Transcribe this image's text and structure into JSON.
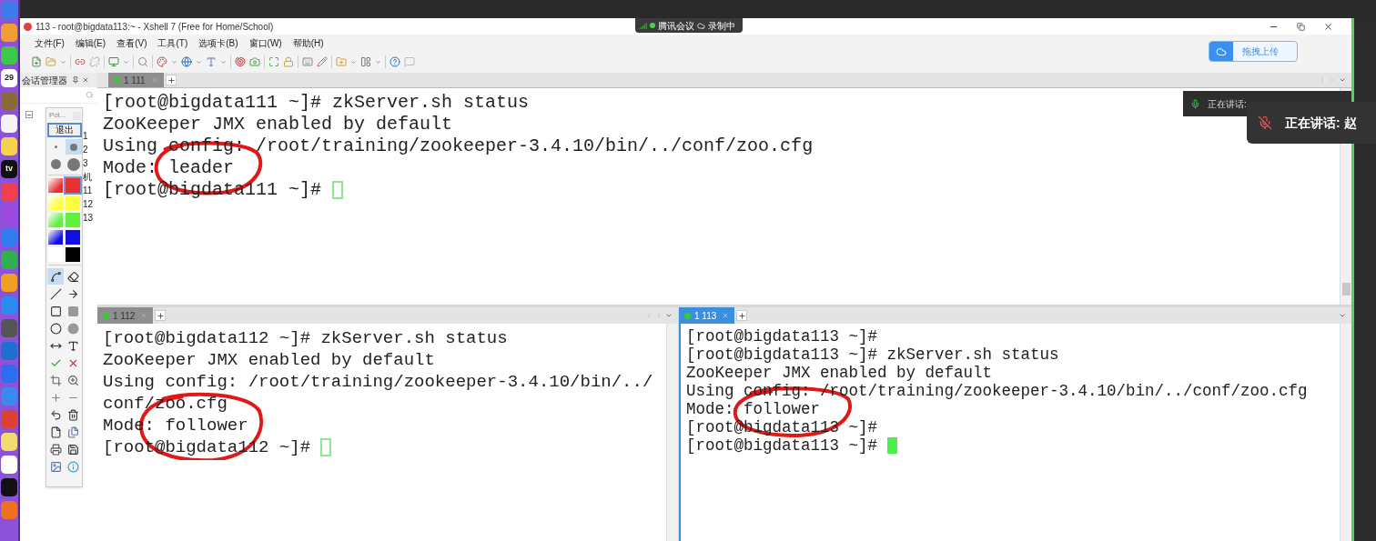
{
  "window": {
    "title": "113 - root@bigdata113:~ - Xshell 7 (Free for Home/School)"
  },
  "menu": [
    "文件(F)",
    "编辑(E)",
    "查看(V)",
    "工具(T)",
    "选项卡(B)",
    "窗口(W)",
    "帮助(H)"
  ],
  "session_manager": {
    "title": "会话管理器",
    "tree_fragments": [
      "1",
      "2",
      "3",
      "机",
      "11",
      "12",
      "13"
    ]
  },
  "panes": [
    {
      "tab": {
        "label": "1 111",
        "selected": false
      },
      "focused": false,
      "lines": [
        "[root@bigdata111 ~]# zkServer.sh status",
        "ZooKeeper JMX enabled by default",
        "Using config: /root/training/zookeeper-3.4.10/bin/../conf/zoo.cfg",
        "Mode: leader",
        "[root@bigdata111 ~]# "
      ]
    },
    {
      "tab": {
        "label": "1 112",
        "selected": false
      },
      "focused": false,
      "lines": [
        "[root@bigdata112 ~]# zkServer.sh status",
        "ZooKeeper JMX enabled by default",
        "Using config: /root/training/zookeeper-3.4.10/bin/../",
        "conf/zoo.cfg",
        "Mode: follower",
        "[root@bigdata112 ~]# "
      ]
    },
    {
      "tab": {
        "label": "1 113",
        "selected": true
      },
      "focused": true,
      "lines": [
        "[root@bigdata113 ~]#",
        "[root@bigdata113 ~]# zkServer.sh status",
        "ZooKeeper JMX enabled by default",
        "Using config: /root/training/zookeeper-3.4.10/bin/../conf/zoo.cfg",
        "Mode: follower",
        "[root@bigdata113 ~]#",
        "[root@bigdata113 ~]# "
      ]
    }
  ],
  "cloud_upload_button": {
    "label": "拖拽上传"
  },
  "meeting_badge": {
    "app": "腾讯会议",
    "status": "录制中"
  },
  "toasts": [
    {
      "text": "正在讲话:",
      "muted": false
    },
    {
      "text": "正在讲话: 赵",
      "muted": true
    }
  ],
  "pointofix": {
    "title": "Poi...",
    "exit_button": "退出",
    "sizes": [
      {
        "selected": false
      },
      {
        "selected": true
      },
      {
        "selected": false
      },
      {
        "selected": false
      }
    ],
    "swatches": [
      {
        "kind": "gradient",
        "color": "#e83030",
        "selected": false
      },
      {
        "kind": "solid",
        "color": "#e83030",
        "selected": true
      },
      {
        "kind": "gradient",
        "color": "#ffff40",
        "selected": false
      },
      {
        "kind": "solid",
        "color": "#ffff40",
        "selected": false
      },
      {
        "kind": "gradient",
        "color": "#60f040",
        "selected": false
      },
      {
        "kind": "solid",
        "color": "#60f040",
        "selected": false
      },
      {
        "kind": "gradient",
        "color": "#1010e0",
        "selected": false
      },
      {
        "kind": "solid",
        "color": "#1010e0",
        "selected": false
      },
      {
        "kind": "solid",
        "color": "#ffffff",
        "selected": false
      },
      {
        "kind": "solid",
        "color": "#000000",
        "selected": false
      }
    ],
    "tools": [
      {
        "kind": "freehand",
        "selected": true
      },
      {
        "kind": "eraser",
        "selected": false
      },
      {
        "kind": "line",
        "selected": false
      },
      {
        "kind": "arrow",
        "selected": false
      },
      {
        "kind": "rect",
        "selected": false
      },
      {
        "kind": "rect-filled",
        "selected": false
      },
      {
        "kind": "ellipse",
        "selected": false
      },
      {
        "kind": "ellipse-filled",
        "selected": false
      },
      {
        "kind": "double-arrow",
        "selected": false
      },
      {
        "kind": "text",
        "selected": false
      },
      {
        "kind": "confirm",
        "selected": false
      },
      {
        "kind": "cancel",
        "selected": false
      },
      {
        "kind": "crop",
        "selected": false
      },
      {
        "kind": "zoom",
        "selected": false
      },
      {
        "kind": "plus",
        "selected": false
      },
      {
        "kind": "minus",
        "selected": false
      },
      {
        "kind": "undo",
        "selected": false
      },
      {
        "kind": "delete",
        "selected": false
      },
      {
        "kind": "new",
        "selected": false
      },
      {
        "kind": "copy",
        "selected": false
      },
      {
        "kind": "print",
        "selected": false
      },
      {
        "kind": "save",
        "selected": false
      },
      {
        "kind": "image",
        "selected": false
      },
      {
        "kind": "info",
        "selected": false
      }
    ]
  },
  "dock": [
    {
      "color": "#3d7be8"
    },
    {
      "color": "#f0a030"
    },
    {
      "color": "#3cc84a"
    },
    {
      "color": "#ffffff",
      "label": "29"
    },
    {
      "color": "#8a6a3a"
    },
    {
      "color": "#f4f4f4"
    },
    {
      "color": "#f6d050"
    },
    {
      "color": "#111111",
      "label": "tv"
    },
    {
      "color": "#f04050"
    },
    {
      "color": "#9a4ae0"
    },
    {
      "color": "#2f7cf0"
    },
    {
      "color": "#30b050"
    },
    {
      "color": "#f0a020"
    },
    {
      "color": "#2a8cf0"
    },
    {
      "color": "#555555"
    },
    {
      "color": "#1f6fd0"
    },
    {
      "color": "#2d6df0"
    },
    {
      "color": "#3a8af0"
    },
    {
      "color": "#e04030"
    },
    {
      "color": "#f2dc70"
    },
    {
      "color": "#ffffff"
    },
    {
      "color": "#111111"
    },
    {
      "color": "#f07020"
    }
  ]
}
